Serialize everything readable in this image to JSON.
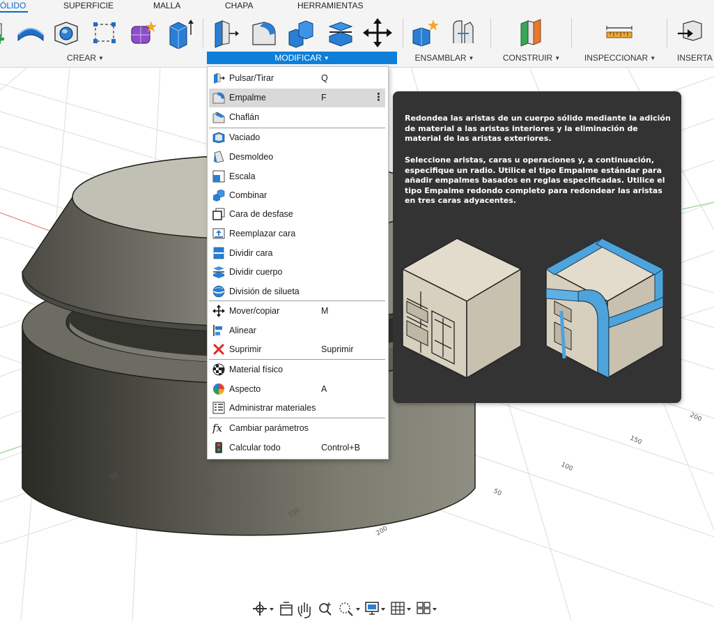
{
  "ribbon": {
    "tabs": [
      "ÓLIDO",
      "SUPERFICIE",
      "MALLA",
      "CHAPA",
      "HERRAMIENTAS"
    ],
    "groups": {
      "crear": "CREAR",
      "modificar": "MODIFICAR",
      "ensamblar": "ENSAMBLAR",
      "construir": "CONSTRUIR",
      "inspeccionar": "INSPECCIONAR",
      "insertar": "INSERTA"
    },
    "accent": "#0d7fd9"
  },
  "menu": {
    "items": [
      {
        "label": "Pulsar/Tirar",
        "shortcut": "Q",
        "icon": "push-pull-icon"
      },
      {
        "label": "Empalme",
        "shortcut": "F",
        "icon": "fillet-icon"
      },
      {
        "label": "Chaflán",
        "shortcut": "",
        "icon": "chamfer-icon"
      },
      {
        "label": "Vaciado",
        "shortcut": "",
        "icon": "shell-icon"
      },
      {
        "label": "Desmoldeo",
        "shortcut": "",
        "icon": "draft-icon"
      },
      {
        "label": "Escala",
        "shortcut": "",
        "icon": "scale-icon"
      },
      {
        "label": "Combinar",
        "shortcut": "",
        "icon": "combine-icon"
      },
      {
        "label": "Cara de desfase",
        "shortcut": "",
        "icon": "offset-face-icon"
      },
      {
        "label": "Reemplazar cara",
        "shortcut": "",
        "icon": "replace-face-icon"
      },
      {
        "label": "Dividir cara",
        "shortcut": "",
        "icon": "split-face-icon"
      },
      {
        "label": "Dividir cuerpo",
        "shortcut": "",
        "icon": "split-body-icon"
      },
      {
        "label": "División de silueta",
        "shortcut": "",
        "icon": "silhouette-split-icon"
      },
      {
        "label": "Mover/copiar",
        "shortcut": "M",
        "icon": "move-icon"
      },
      {
        "label": "Alinear",
        "shortcut": "",
        "icon": "align-icon"
      },
      {
        "label": "Suprimir",
        "shortcut": "Suprimir",
        "icon": "delete-icon"
      },
      {
        "label": "Material físico",
        "shortcut": "",
        "icon": "physical-material-icon"
      },
      {
        "label": "Aspecto",
        "shortcut": "A",
        "icon": "appearance-icon"
      },
      {
        "label": "Administrar materiales",
        "shortcut": "",
        "icon": "manage-materials-icon"
      },
      {
        "label": "Cambiar parámetros",
        "shortcut": "",
        "icon": "parameters-icon"
      },
      {
        "label": "Calcular todo",
        "shortcut": "Control+B",
        "icon": "compute-all-icon"
      }
    ]
  },
  "tooltip": {
    "paragraph1": "Redondea las aristas de un cuerpo sólido mediante la adición de material a las aristas interiores y la eliminación de material de las aristas exteriores.",
    "paragraph2": "Seleccione aristas, caras u operaciones y, a continuación, especifique un radio. Utilice el tipo Empalme estándar para añadir empalmes basados en reglas especificadas. Utilice el tipo Empalme redondo completo para redondear las aristas en tres caras adyacentes.",
    "fillet_color": "#4fa3db"
  },
  "viewport": {
    "ruler_labels": [
      "50",
      "100",
      "150",
      "200",
      "50",
      "100",
      "150",
      "200",
      "250"
    ]
  },
  "navbar": {
    "tools": [
      "orbit-icon",
      "look-at-icon",
      "pan-icon",
      "zoom-icon",
      "fit-icon",
      "display-icon",
      "grid-icon",
      "viewports-icon"
    ]
  }
}
